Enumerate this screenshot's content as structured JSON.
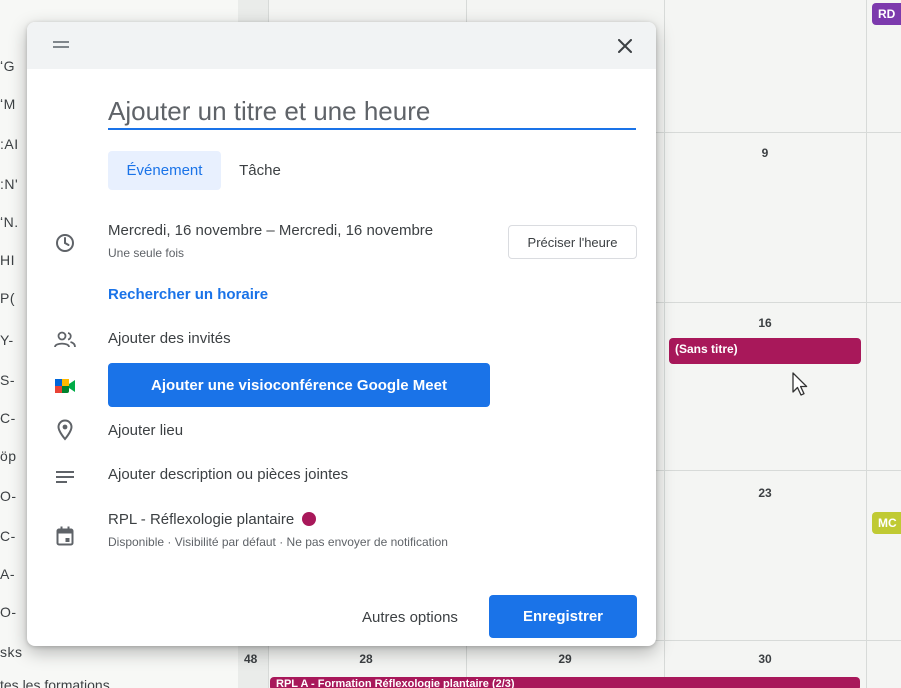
{
  "calendar": {
    "sidebar_fragments": [
      "ʻG",
      "ʻM",
      ":AI",
      ":N'",
      "ʻN.",
      "HI",
      "P(",
      "Y-",
      "S-",
      "C-",
      "öp",
      "O-",
      "C-",
      "A-",
      "O-",
      "sks"
    ],
    "bottom_text": "tes les formations",
    "week_number": "48",
    "day_numbers": {
      "d9": "9",
      "d16": "16",
      "d23": "23",
      "d28": "28",
      "d29": "29",
      "d30": "30"
    },
    "events": {
      "top_right": "RD",
      "sans_titre": "(Sans titre)",
      "right_mid": "MC",
      "bottom_bar": "RPL A - Formation Réflexologie plantaire (2/3)"
    },
    "colors": {
      "purple": "#7c3aad",
      "magenta": "#a8185a",
      "olive": "#c0ca33",
      "accent": "#1a73e8"
    }
  },
  "dialog": {
    "close_icon": "close-icon",
    "title_placeholder": "Ajouter un titre et une heure",
    "tabs": {
      "event": "Événement",
      "task": "Tâche"
    },
    "date_range": "Mercredi, 16 novembre  –  Mercredi, 16 novembre",
    "recurrence": "Une seule fois",
    "precise_time_button": "Préciser l'heure",
    "find_time_link": "Rechercher un horaire",
    "add_guests": "Ajouter des invités",
    "meet_button": "Ajouter une visioconférence Google Meet",
    "add_location": "Ajouter lieu",
    "add_description": "Ajouter description ou pièces jointes",
    "calendar_name": "RPL - Réflexologie plantaire",
    "calendar_details": "Disponible · Visibilité par défaut · Ne pas envoyer de notification",
    "more_options_button": "Autres options",
    "save_button": "Enregistrer"
  }
}
